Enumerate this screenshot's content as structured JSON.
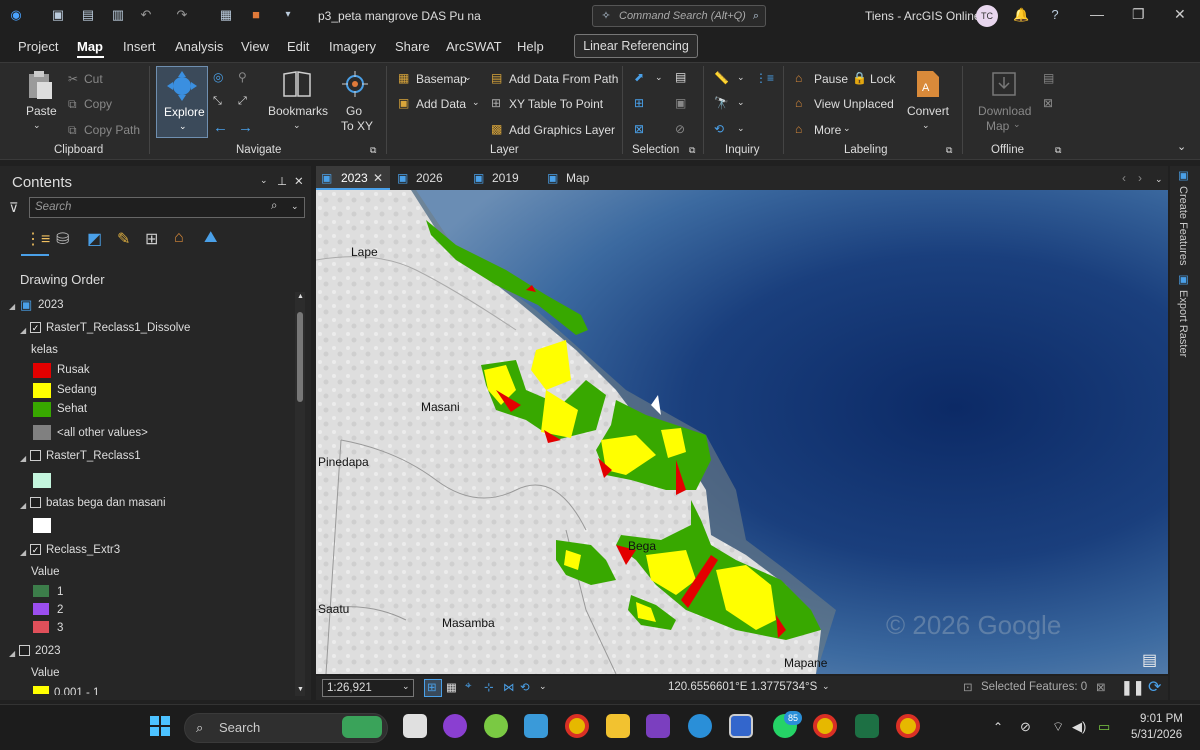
{
  "title_bar": {
    "doc_title": "p3_peta mangrove DAS Pu na",
    "command_search_placeholder": "Command Search (Alt+Q)",
    "user": "Tiens - ArcGIS Online",
    "avatar_initials": "TC",
    "help": "?"
  },
  "menu": {
    "tabs": [
      "Project",
      "Map",
      "Insert",
      "Analysis",
      "View",
      "Edit",
      "Imagery",
      "Share",
      "ArcSWAT",
      "Help"
    ],
    "active_tab": "Map",
    "contextual_button": "Linear Referencing"
  },
  "ribbon": {
    "clipboard": {
      "paste": "Paste",
      "cut": "Cut",
      "copy": "Copy",
      "copy_path": "Copy Path",
      "group": "Clipboard"
    },
    "navigate": {
      "explore": "Explore",
      "bookmarks": "Bookmarks",
      "go_to_xy_1": "Go",
      "go_to_xy_2": "To XY",
      "group": "Navigate"
    },
    "layer": {
      "basemap": "Basemap",
      "add_data": "Add Data",
      "add_data_from_path": "Add Data From Path",
      "xy_table": "XY Table To Point",
      "add_graphics_layer": "Add Graphics Layer",
      "group": "Layer"
    },
    "selection": {
      "group": "Selection"
    },
    "inquiry": {
      "group": "Inquiry"
    },
    "labeling": {
      "pause": "Pause",
      "lock": "Lock",
      "view_unplaced": "View Unplaced",
      "more": "More",
      "convert": "Convert",
      "group": "Labeling"
    },
    "offline": {
      "download_1": "Download",
      "download_2": "Map",
      "group": "Offline"
    }
  },
  "contents": {
    "title": "Contents",
    "search_placeholder": "Search",
    "drawing_order": "Drawing Order",
    "map_2023": "2023",
    "layer1": "RasterT_Reclass1_Dissolve",
    "layer1_field": "kelas",
    "layer1_classes": [
      "Rusak",
      "Sedang",
      "Sehat",
      "<all other values>"
    ],
    "layer2": "RasterT_Reclass1",
    "layer3": "batas bega dan masani",
    "layer4": "Reclass_Extr3",
    "layer4_field": "Value",
    "layer4_classes": [
      "1",
      "2",
      "3"
    ],
    "layer5": "2023",
    "layer5_field": "Value",
    "layer5_class": "0.001 - 1"
  },
  "map_tabs": [
    "2023",
    "2026",
    "2019",
    "Map"
  ],
  "map_labels": {
    "lape": "Lape",
    "masani": "Masani",
    "pinedapa": "Pinedapa",
    "bega": "Bega",
    "saatu": "Saatu",
    "masamba": "Masamba",
    "mapane": "Mapane",
    "watermark": "© 2026 Google"
  },
  "map_status": {
    "scale": "1:26,921",
    "coords": "120.6556601°E 1.3775734°S",
    "selected_features": "Selected Features: 0"
  },
  "side_panel": {
    "create_features": "Create Features",
    "export_raster": "Export Raster"
  },
  "taskbar": {
    "search": "Search",
    "whatsapp_badge": "85",
    "time": "9:01 PM",
    "date": "5/31/2026"
  },
  "colors": {
    "rusak": "#e30000",
    "sedang": "#ffff00",
    "sehat": "#38a800",
    "other": "#808080",
    "value1": "#3c7d4a",
    "value2": "#9b4ef0",
    "value3": "#e0505a"
  }
}
